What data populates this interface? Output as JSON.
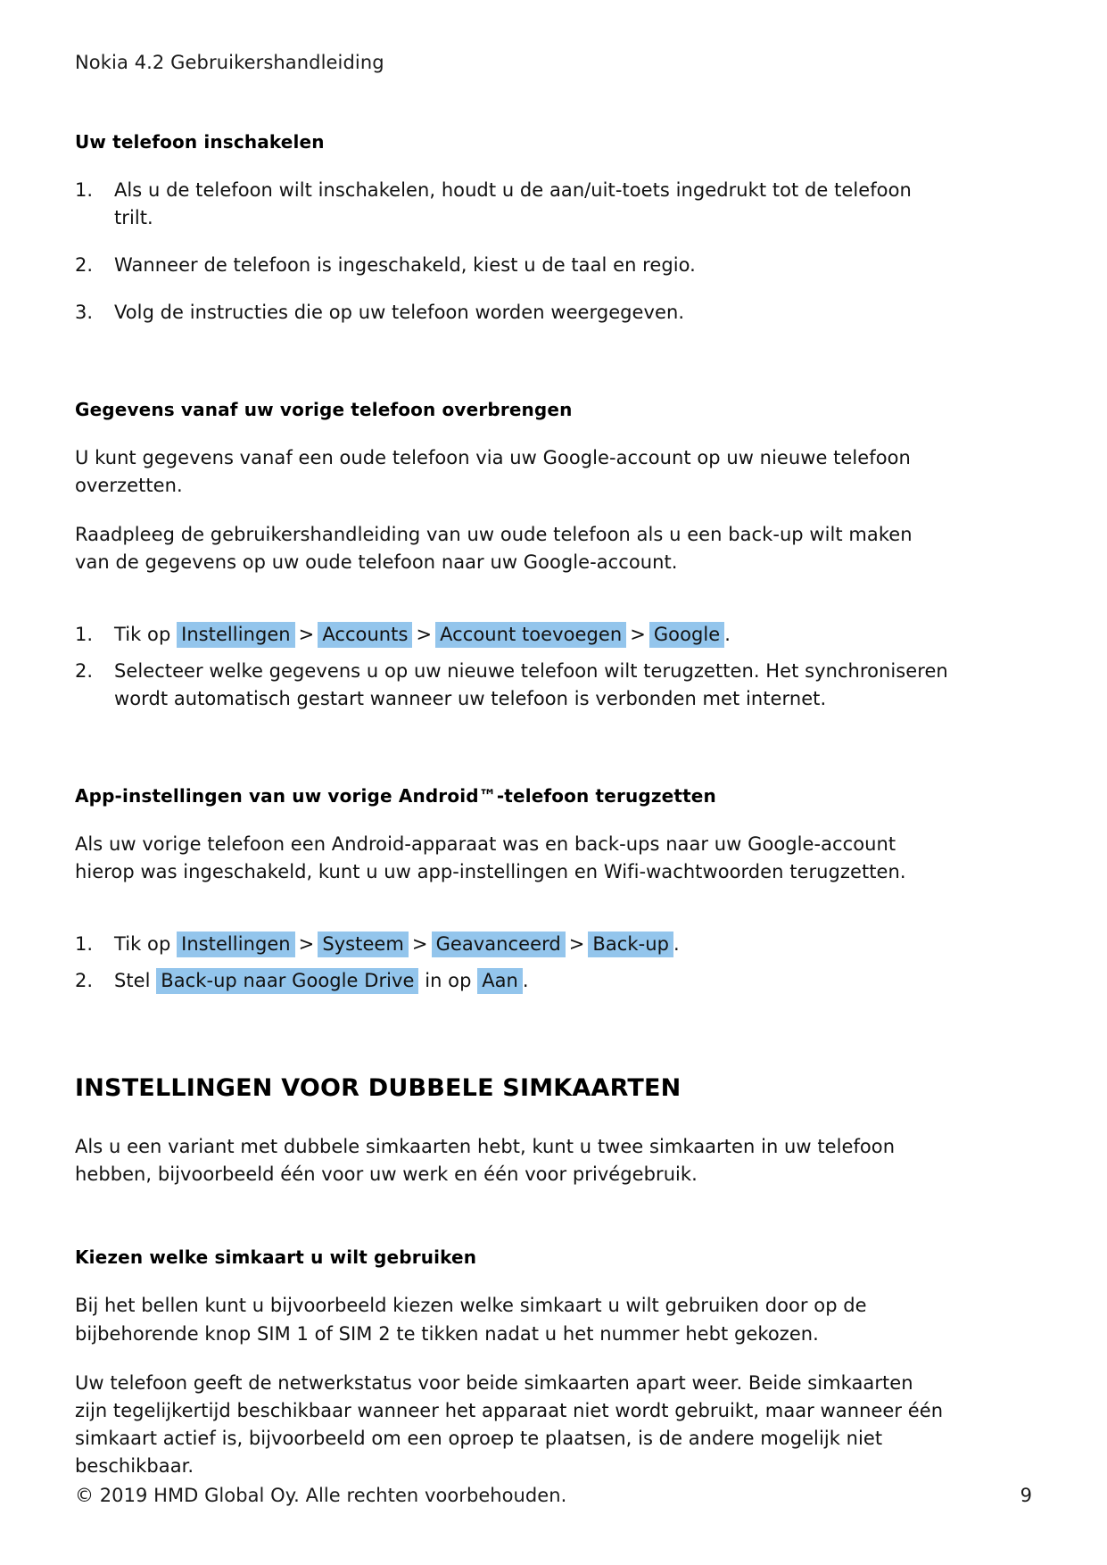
{
  "document": {
    "running_head": "Nokia 4.2 Gebruikershandleiding",
    "highlight_color": "#93c5ec",
    "breadcrumb_separator": ">"
  },
  "sections": {
    "power_on": {
      "heading": "Uw telefoon inschakelen",
      "steps": [
        "Als u de telefoon wilt inschakelen, houdt u de aan/uit-toets ingedrukt tot de telefoon trilt.",
        "Wanneer de telefoon is ingeschakeld, kiest u de taal en regio.",
        "Volg de instructies die op uw telefoon worden weergegeven."
      ]
    },
    "transfer_data": {
      "heading": "Gegevens vanaf uw vorige telefoon overbrengen",
      "paragraph_1": "U kunt gegevens vanaf een oude telefoon via uw Google-account op uw nieuwe telefoon overzetten.",
      "paragraph_2": "Raadpleeg de gebruikershandleiding van uw oude telefoon als u een back-up wilt maken van de gegevens op uw oude telefoon naar uw Google-account.",
      "step_1_prefix": "Tik op",
      "step_1_path": [
        "Instellingen",
        "Accounts",
        "Account toevoegen",
        "Google"
      ],
      "step_1_suffix": ".",
      "step_2": "Selecteer welke gegevens u op uw nieuwe telefoon wilt terugzetten. Het synchroniseren wordt automatisch gestart wanneer uw telefoon is verbonden met internet."
    },
    "restore_app_settings": {
      "heading": "App-instellingen van uw vorige Android™-telefoon terugzetten",
      "paragraph_1": "Als uw vorige telefoon een Android-apparaat was en back-ups naar uw Google-account hierop was ingeschakeld, kunt u uw app-instellingen en Wifi-wachtwoorden terugzetten.",
      "step_1_prefix": "Tik op",
      "step_1_path": [
        "Instellingen",
        "Systeem",
        "Geavanceerd",
        "Back-up"
      ],
      "step_1_suffix": ".",
      "step_2_prefix": "Stel",
      "step_2_setting": "Back-up naar Google Drive",
      "step_2_middle": "in op",
      "step_2_value": "Aan",
      "step_2_suffix": "."
    },
    "dual_sim": {
      "heading": "INSTELLINGEN VOOR DUBBELE SIMKAARTEN",
      "paragraph_1": "Als u een variant met dubbele simkaarten hebt, kunt u twee simkaarten in uw telefoon hebben, bijvoorbeeld één voor uw werk en één voor privégebruik."
    },
    "choose_sim": {
      "heading": "Kiezen welke simkaart u wilt gebruiken",
      "paragraph_1": "Bij het bellen kunt u bijvoorbeeld kiezen welke simkaart u wilt gebruiken door op de bijbehorende knop SIM 1 of SIM 2 te tikken nadat u het nummer hebt gekozen.",
      "paragraph_2": "Uw telefoon geeft de netwerkstatus voor beide simkaarten apart weer. Beide simkaarten zijn tegelijkertijd beschikbaar wanneer het apparaat niet wordt gebruikt, maar wanneer één simkaart actief is, bijvoorbeeld om een oproep te plaatsen, is de andere mogelijk niet beschikbaar."
    }
  },
  "footer": {
    "copyright": "© 2019 HMD Global Oy. Alle rechten voorbehouden.",
    "page_number": "9"
  }
}
